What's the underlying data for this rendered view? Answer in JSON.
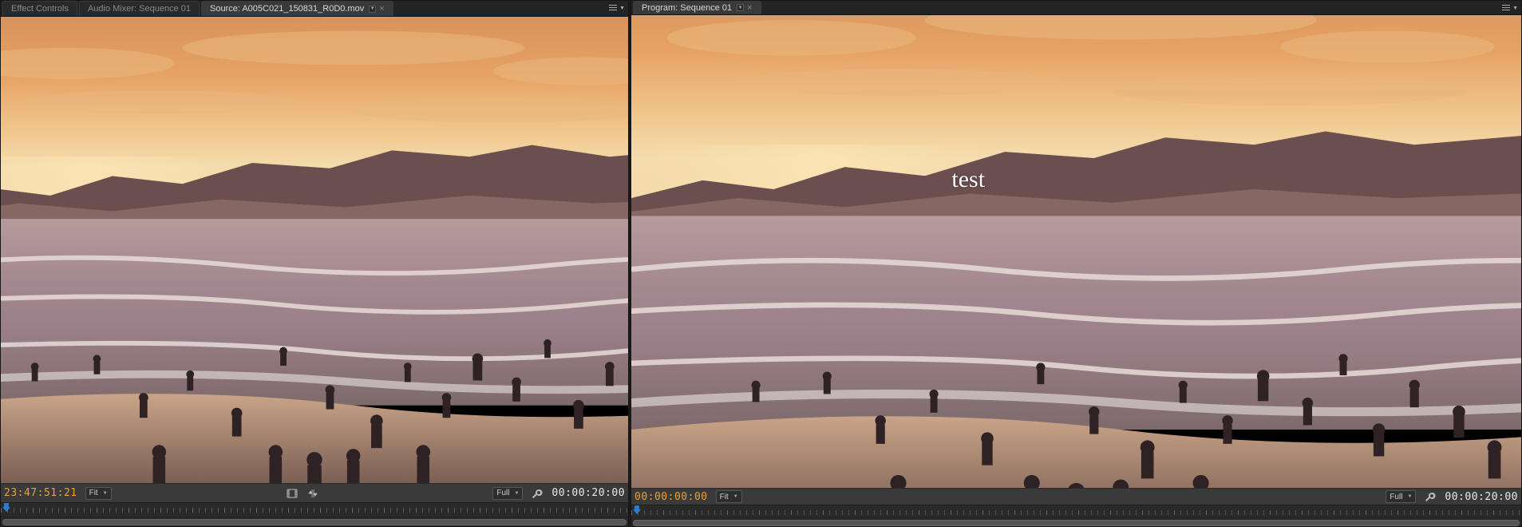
{
  "source_panel": {
    "tabs": [
      {
        "label": "Effect Controls",
        "active": false
      },
      {
        "label": "Audio Mixer: Sequence 01",
        "active": false
      },
      {
        "label": "Source: A005C021_150831_R0D0.mov",
        "active": true
      }
    ],
    "playhead_tc": "23:47:51:21",
    "duration_tc": "00:00:20:00",
    "zoom_label": "Fit",
    "resolution_label": "Full",
    "center_icons": {
      "film": "film-strip-icon",
      "arrows": "insert-overwrite-icon"
    }
  },
  "program_panel": {
    "tabs": [
      {
        "label": "Program: Sequence 01",
        "active": true
      }
    ],
    "overlay_text": "test",
    "playhead_tc": "00:00:00:00",
    "duration_tc": "00:00:20:00",
    "zoom_label": "Fit",
    "resolution_label": "Full"
  },
  "colors": {
    "tc_playhead": "#e6a23c",
    "tc_duration": "#e8e8e8",
    "panel_bg": "#232323",
    "control_bg": "#3a3a3a"
  }
}
